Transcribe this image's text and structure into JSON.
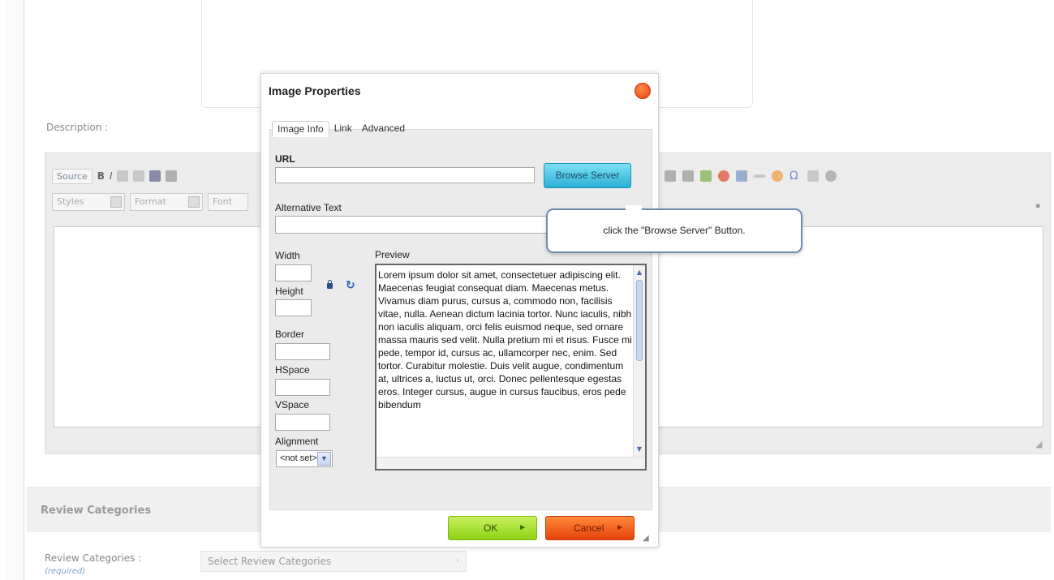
{
  "page": {
    "description_label": "Description :",
    "review_section_title": "Review Categories",
    "review_field_label": "Review Categories :",
    "review_required": "(required)",
    "review_select_placeholder": "Select Review Categories"
  },
  "editor": {
    "toolbar": {
      "source": "Source",
      "bold": "B",
      "italic": "I",
      "styles": "Styles",
      "format": "Format",
      "font": "Font"
    }
  },
  "dialog": {
    "title": "Image Properties",
    "tabs": [
      {
        "label": "Image Info",
        "active": true
      },
      {
        "label": "Link",
        "active": false
      },
      {
        "label": "Advanced",
        "active": false
      }
    ],
    "url_label": "URL",
    "url_value": "",
    "browse_button": "Browse Server",
    "alt_label": "Alternative Text",
    "alt_value": "",
    "width_label": "Width",
    "height_label": "Height",
    "border_label": "Border",
    "hspace_label": "HSpace",
    "vspace_label": "VSpace",
    "alignment_label": "Alignment",
    "alignment_value": "<not set>",
    "preview_label": "Preview",
    "preview_text": "Lorem ipsum dolor sit amet, consectetuer adipiscing elit. Maecenas feugiat consequat diam. Maecenas metus. Vivamus diam purus, cursus a, commodo non, facilisis vitae, nulla. Aenean dictum lacinia tortor. Nunc iaculis, nibh non iaculis aliquam, orci felis euismod neque, sed ornare massa mauris sed velit. Nulla pretium mi et risus. Fusce mi pede, tempor id, cursus ac, ullamcorper nec, enim. Sed tortor. Curabitur molestie. Duis velit augue, condimentum at, ultrices a, luctus ut, orci. Donec pellentesque egestas eros. Integer cursus, augue in cursus faucibus, eros pede bibendum",
    "ok_button": "OK",
    "cancel_button": "Cancel"
  },
  "callout": {
    "text": "click the \"Browse Server\" Button."
  },
  "colors": {
    "browse_button": "#2ab0d8",
    "ok_button": "#8fd214",
    "cancel_button": "#e6420b",
    "close_button": "#e2420c",
    "callout_border": "#6e8bb0"
  }
}
